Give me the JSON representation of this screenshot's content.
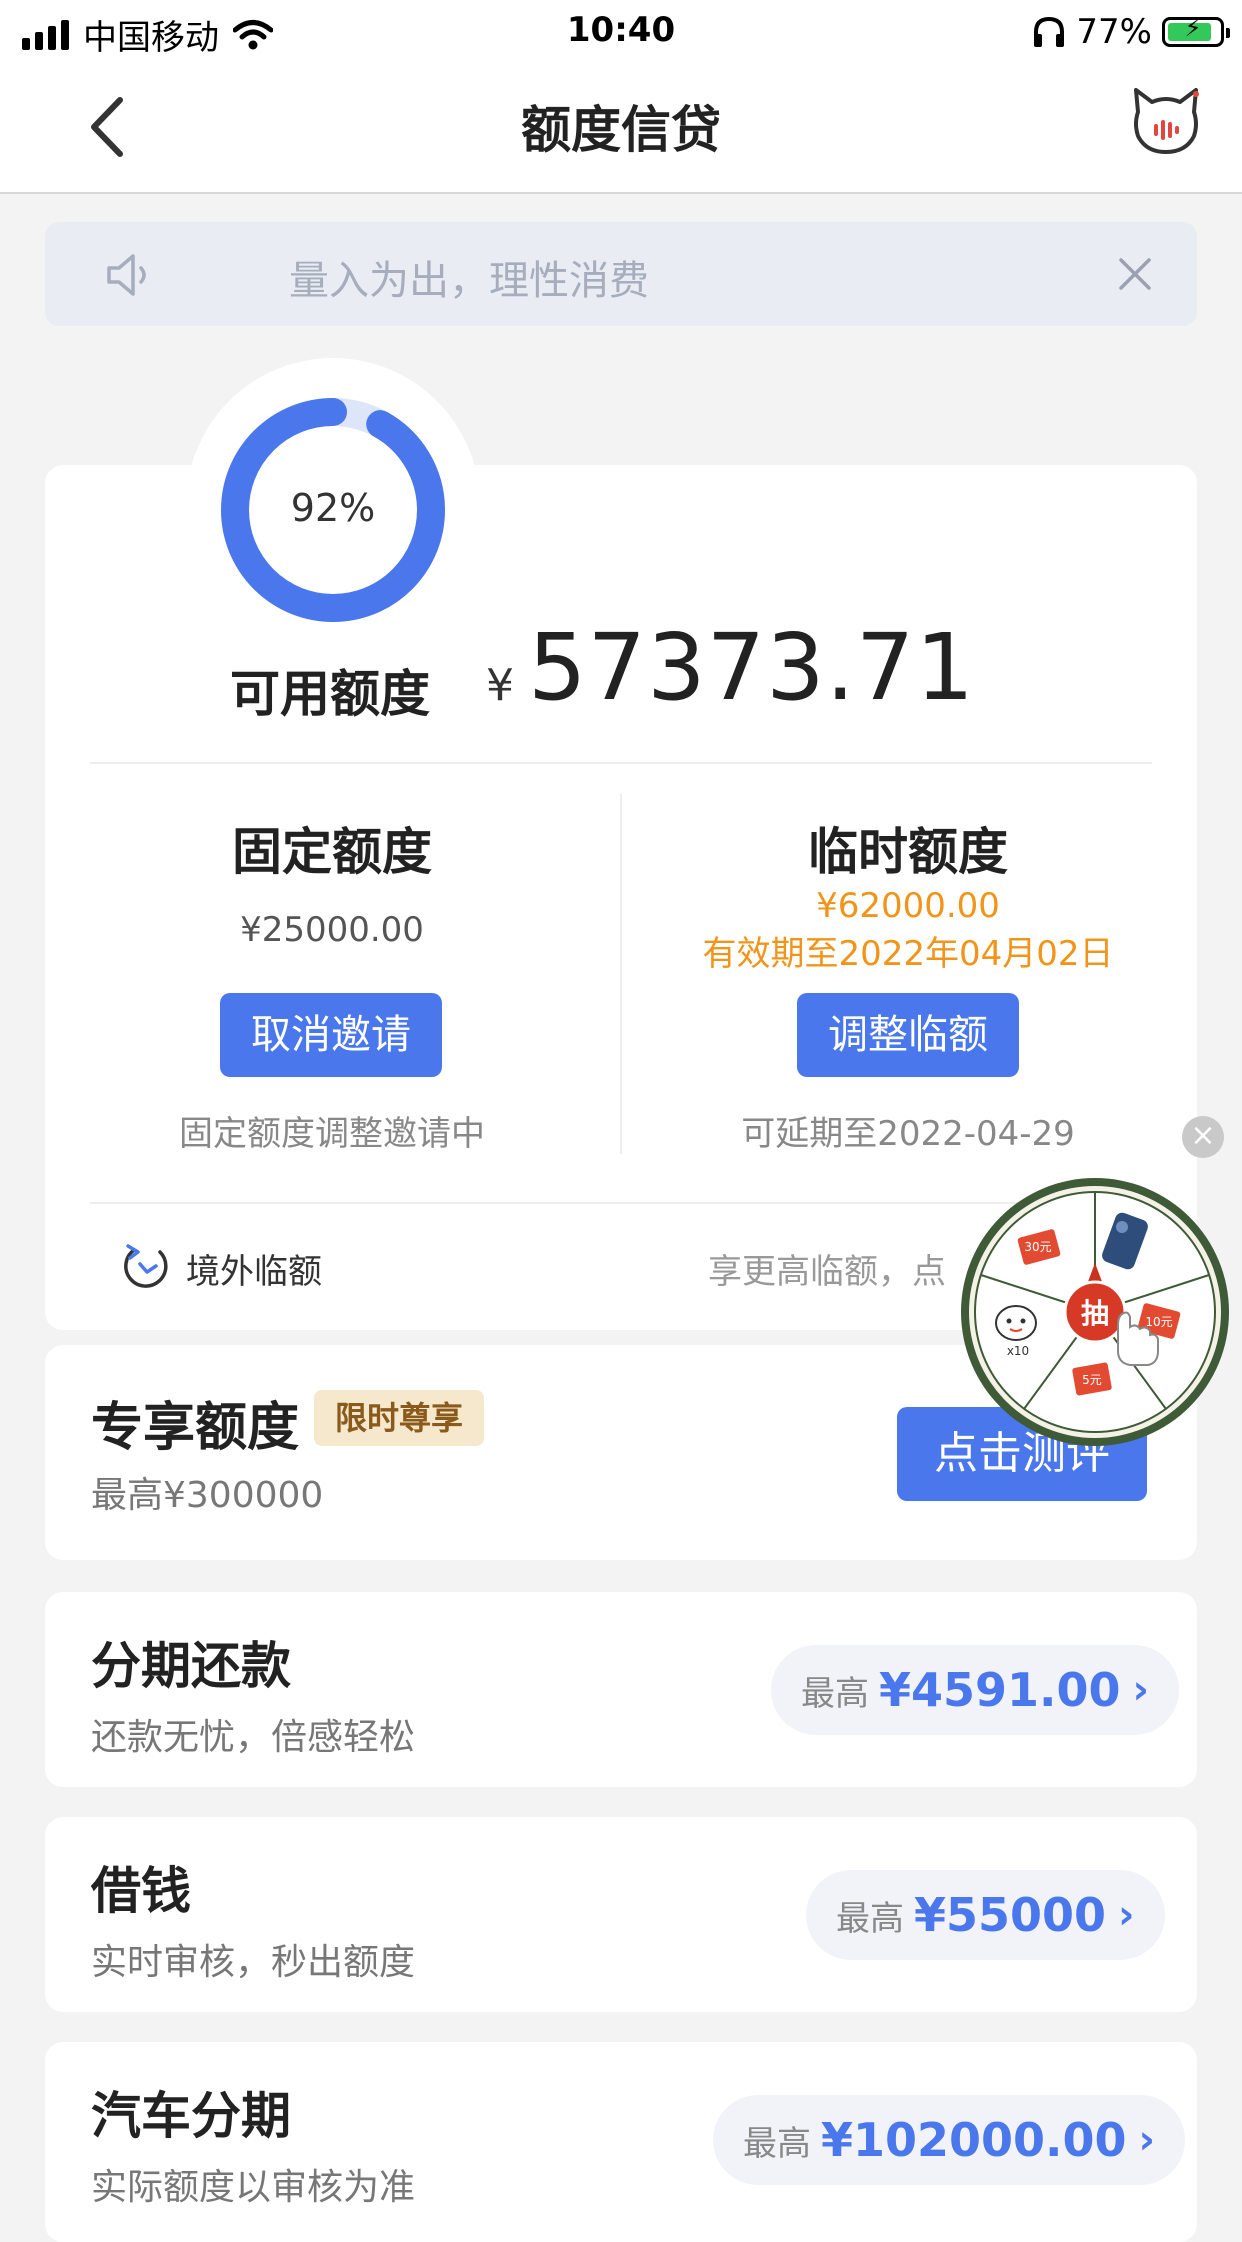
{
  "status_bar": {
    "carrier": "中国移动",
    "time": "10:40",
    "battery": "77%"
  },
  "nav": {
    "title": "额度信贷"
  },
  "notice": {
    "text": "量入为出，理性消费"
  },
  "usage": {
    "percent_label": "92%",
    "percent": 92
  },
  "available": {
    "label": "可用额度",
    "currency": "¥",
    "amount": "57373.71"
  },
  "fixed": {
    "title": "固定额度",
    "amount": "¥25000.00",
    "button": "取消邀请",
    "note": "固定额度调整邀请中"
  },
  "temporary": {
    "title": "临时额度",
    "amount": "¥62000.00",
    "expiry": "有效期至2022年04月02日",
    "button": "调整临额",
    "note": "可延期至2022-04-29"
  },
  "overseas": {
    "label": "境外临额",
    "right_text": "享更高临额，点"
  },
  "exclusive": {
    "title": "专享额度",
    "badge": "限时尊享",
    "sub": "最高¥300000",
    "button": "点击测评"
  },
  "lottery": {
    "center": "抽",
    "prizes": [
      "30元",
      "5元",
      "10元",
      "x10"
    ]
  },
  "products": [
    {
      "title": "分期还款",
      "sub": "还款无忧，倍感轻松",
      "pre": "最高",
      "value": "¥4591.00",
      "chev": "›"
    },
    {
      "title": "借钱",
      "sub": "实时审核，秒出额度",
      "pre": "最高",
      "value": "¥55000",
      "chev": "›"
    },
    {
      "title": "汽车分期",
      "sub": "实际额度以审核为准",
      "pre": "最高",
      "value": "¥102000.00",
      "chev": "›"
    }
  ],
  "colors": {
    "accent": "#4a78ec",
    "orange": "#f0951a",
    "background": "#f3f3f4"
  }
}
